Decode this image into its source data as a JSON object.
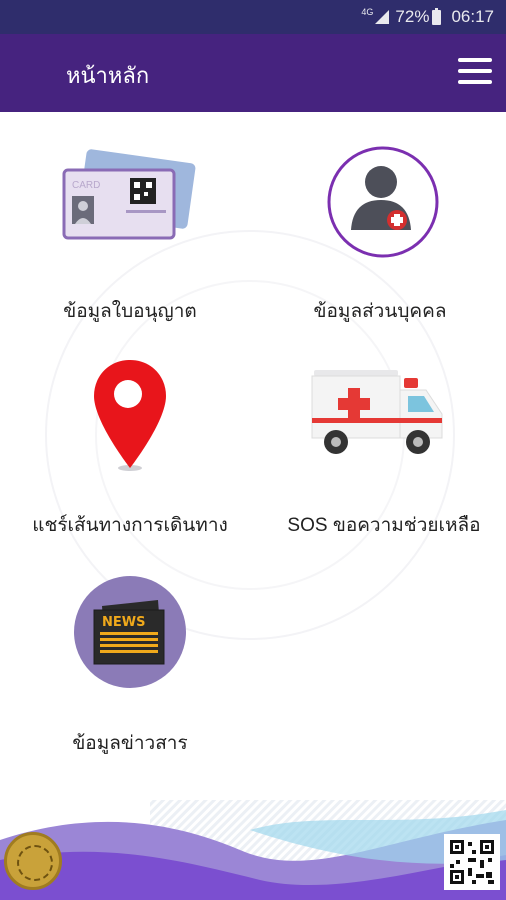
{
  "status_bar": {
    "network": "4G",
    "battery": "72%",
    "time": "06:17"
  },
  "app_bar": {
    "title": "หน้าหลัก",
    "menu_icon": "hamburger-menu-icon"
  },
  "menu": {
    "items": [
      {
        "label": "ข้อมูลใบอนุญาต",
        "icon": "license-card-icon"
      },
      {
        "label": "ข้อมูลส่วนบุคคล",
        "icon": "person-icon"
      },
      {
        "label": "แชร์เส้นทางการเดินทาง",
        "icon": "map-pin-icon"
      },
      {
        "label": "SOS  ขอความช่วยเหลือ",
        "icon": "ambulance-icon"
      },
      {
        "label": "ข้อมูลข่าวสาร",
        "icon": "news-icon"
      }
    ]
  },
  "card_icon": {
    "text": "CARD"
  },
  "news_icon": {
    "text": "NEWS"
  },
  "colors": {
    "status_bar": "#2f2d6c",
    "app_bar": "#46237f",
    "accent": "#7b2fb0",
    "pin": "#e8151b",
    "news_circle": "#8b7bb7"
  }
}
